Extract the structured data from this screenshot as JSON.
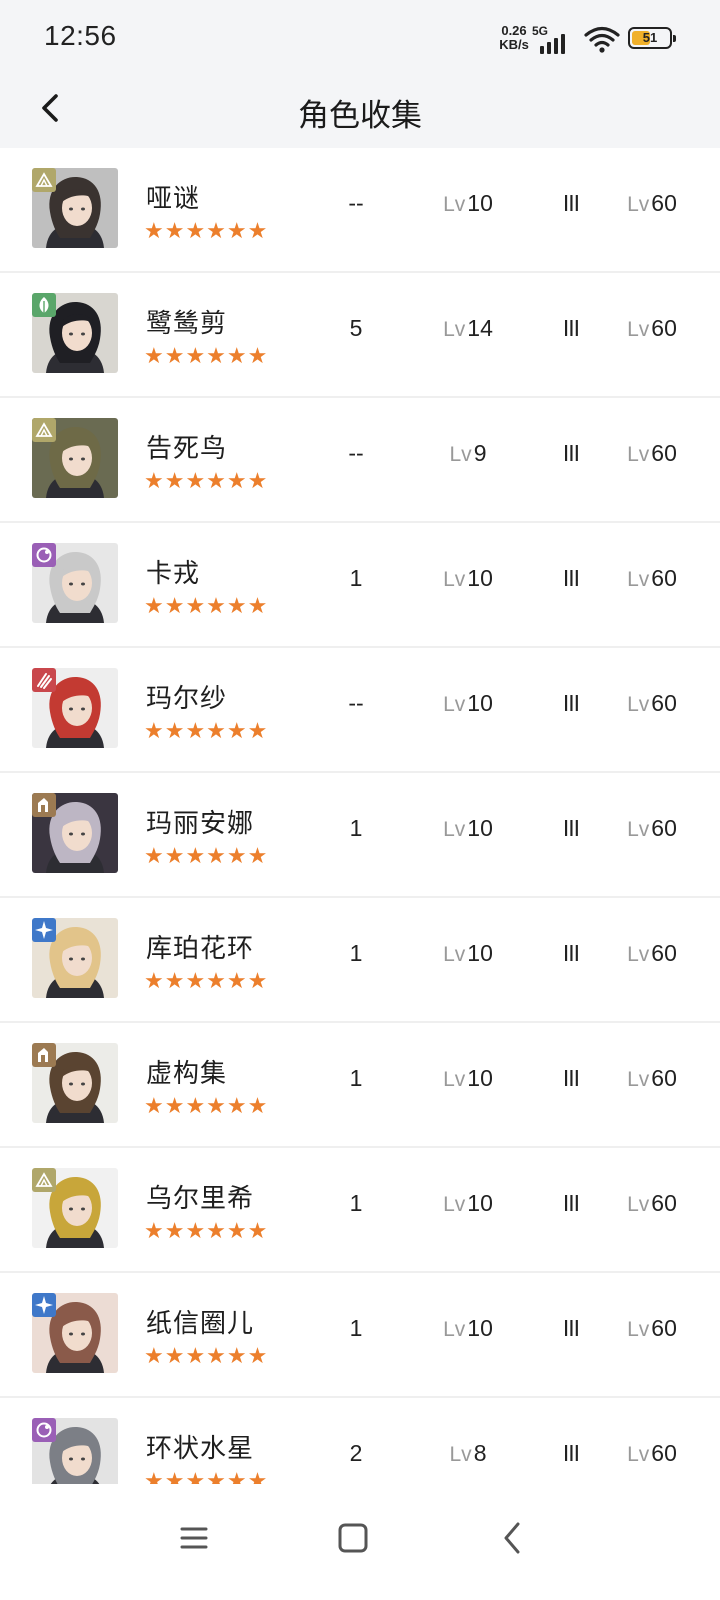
{
  "status": {
    "time": "12:56",
    "speed_top": "0.26",
    "speed_unit": "KB/s",
    "network": "5G",
    "battery": "51"
  },
  "header": {
    "title": "角色收集"
  },
  "characters": [
    {
      "name": "哑谜",
      "stars": "★★★★★★",
      "insight": "--",
      "lv_prefix": "Lv",
      "level": "10",
      "rank": "III",
      "max_prefix": "Lv",
      "max_level": "60",
      "attr": "mineral",
      "attr_color": "#b0a76a",
      "hair": "#3a3330",
      "bg": "#bfbfbf"
    },
    {
      "name": "鹭鸶剪",
      "stars": "★★★★★★",
      "insight": "5",
      "lv_prefix": "Lv",
      "level": "14",
      "rank": "III",
      "max_prefix": "Lv",
      "max_level": "60",
      "attr": "plant",
      "attr_color": "#5aa66a",
      "hair": "#1f1f24",
      "bg": "#d8d6d0"
    },
    {
      "name": "告死鸟",
      "stars": "★★★★★★",
      "insight": "--",
      "lv_prefix": "Lv",
      "level": "9",
      "rank": "III",
      "max_prefix": "Lv",
      "max_level": "60",
      "attr": "mineral",
      "attr_color": "#b0a76a",
      "hair": "#6e6a47",
      "bg": "#6a6b52"
    },
    {
      "name": "卡戎",
      "stars": "★★★★★★",
      "insight": "1",
      "lv_prefix": "Lv",
      "level": "10",
      "rank": "III",
      "max_prefix": "Lv",
      "max_level": "60",
      "attr": "spirit",
      "attr_color": "#9a5fb6",
      "hair": "#c9c9c9",
      "bg": "#e7e7e7"
    },
    {
      "name": "玛尔纱",
      "stars": "★★★★★★",
      "insight": "--",
      "lv_prefix": "Lv",
      "level": "10",
      "rank": "III",
      "max_prefix": "Lv",
      "max_level": "60",
      "attr": "beast",
      "attr_color": "#c9474c",
      "hair": "#c33a32",
      "bg": "#eeeeee"
    },
    {
      "name": "玛丽安娜",
      "stars": "★★★★★★",
      "insight": "1",
      "lv_prefix": "Lv",
      "level": "10",
      "rank": "III",
      "max_prefix": "Lv",
      "max_level": "60",
      "attr": "intellect",
      "attr_color": "#9c7a52",
      "hair": "#bdb6c4",
      "bg": "#3a3540"
    },
    {
      "name": "库珀花环",
      "stars": "★★★★★★",
      "insight": "1",
      "lv_prefix": "Lv",
      "level": "10",
      "rank": "III",
      "max_prefix": "Lv",
      "max_level": "60",
      "attr": "star",
      "attr_color": "#3f78c9",
      "hair": "#e2c48a",
      "bg": "#e9e2d6"
    },
    {
      "name": "虚构集",
      "stars": "★★★★★★",
      "insight": "1",
      "lv_prefix": "Lv",
      "level": "10",
      "rank": "III",
      "max_prefix": "Lv",
      "max_level": "60",
      "attr": "intellect",
      "attr_color": "#9c7a52",
      "hair": "#5a4431",
      "bg": "#ecece8"
    },
    {
      "name": "乌尔里希",
      "stars": "★★★★★★",
      "insight": "1",
      "lv_prefix": "Lv",
      "level": "10",
      "rank": "III",
      "max_prefix": "Lv",
      "max_level": "60",
      "attr": "mineral",
      "attr_color": "#b0a76a",
      "hair": "#c8a63a",
      "bg": "#f1f1f1"
    },
    {
      "name": "纸信圈儿",
      "stars": "★★★★★★",
      "insight": "1",
      "lv_prefix": "Lv",
      "level": "10",
      "rank": "III",
      "max_prefix": "Lv",
      "max_level": "60",
      "attr": "star",
      "attr_color": "#3f78c9",
      "hair": "#8a5a4a",
      "bg": "#ecdcd4"
    },
    {
      "name": "环状水星",
      "stars": "★★★★★★",
      "insight": "2",
      "lv_prefix": "Lv",
      "level": "8",
      "rank": "III",
      "max_prefix": "Lv",
      "max_level": "60",
      "attr": "spirit",
      "attr_color": "#9a5fb6",
      "hair": "#7c7f86",
      "bg": "#e3e3e3"
    }
  ],
  "navbar": {
    "menu_icon": "menu-icon",
    "home_icon": "home-icon",
    "back_icon": "back-icon"
  }
}
